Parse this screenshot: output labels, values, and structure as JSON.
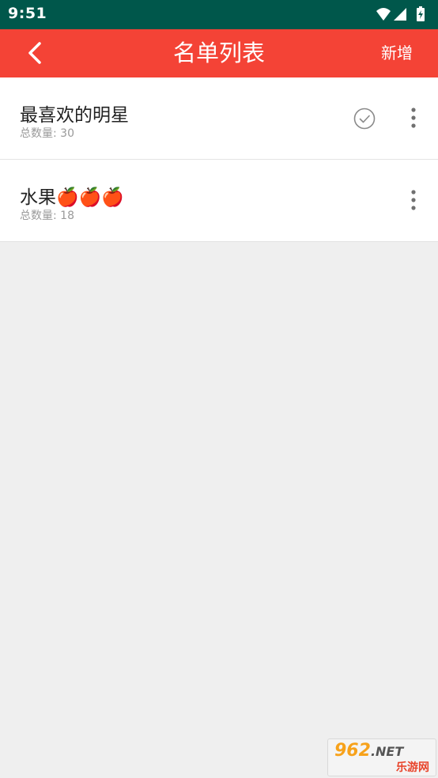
{
  "status_bar": {
    "time": "9:51",
    "icons": [
      "wifi-icon",
      "cell-signal-icon",
      "battery-charging-icon"
    ],
    "background": "#00574b"
  },
  "app_bar": {
    "title": "名单列表",
    "back_icon": "chevron-left-icon",
    "add_label": "新增",
    "background": "#f44336"
  },
  "lists": [
    {
      "title": "最喜欢的明星",
      "count_text": "总数量: 30",
      "selected": true,
      "icons": [
        "check-circle-icon",
        "more-vert-icon"
      ]
    },
    {
      "title": "水果🍎🍎🍎",
      "count_text": "总数量: 18",
      "selected": false,
      "icons": [
        "more-vert-icon"
      ]
    }
  ],
  "watermark": {
    "top": "962",
    "net": ".NET",
    "bottom": "乐游网"
  }
}
